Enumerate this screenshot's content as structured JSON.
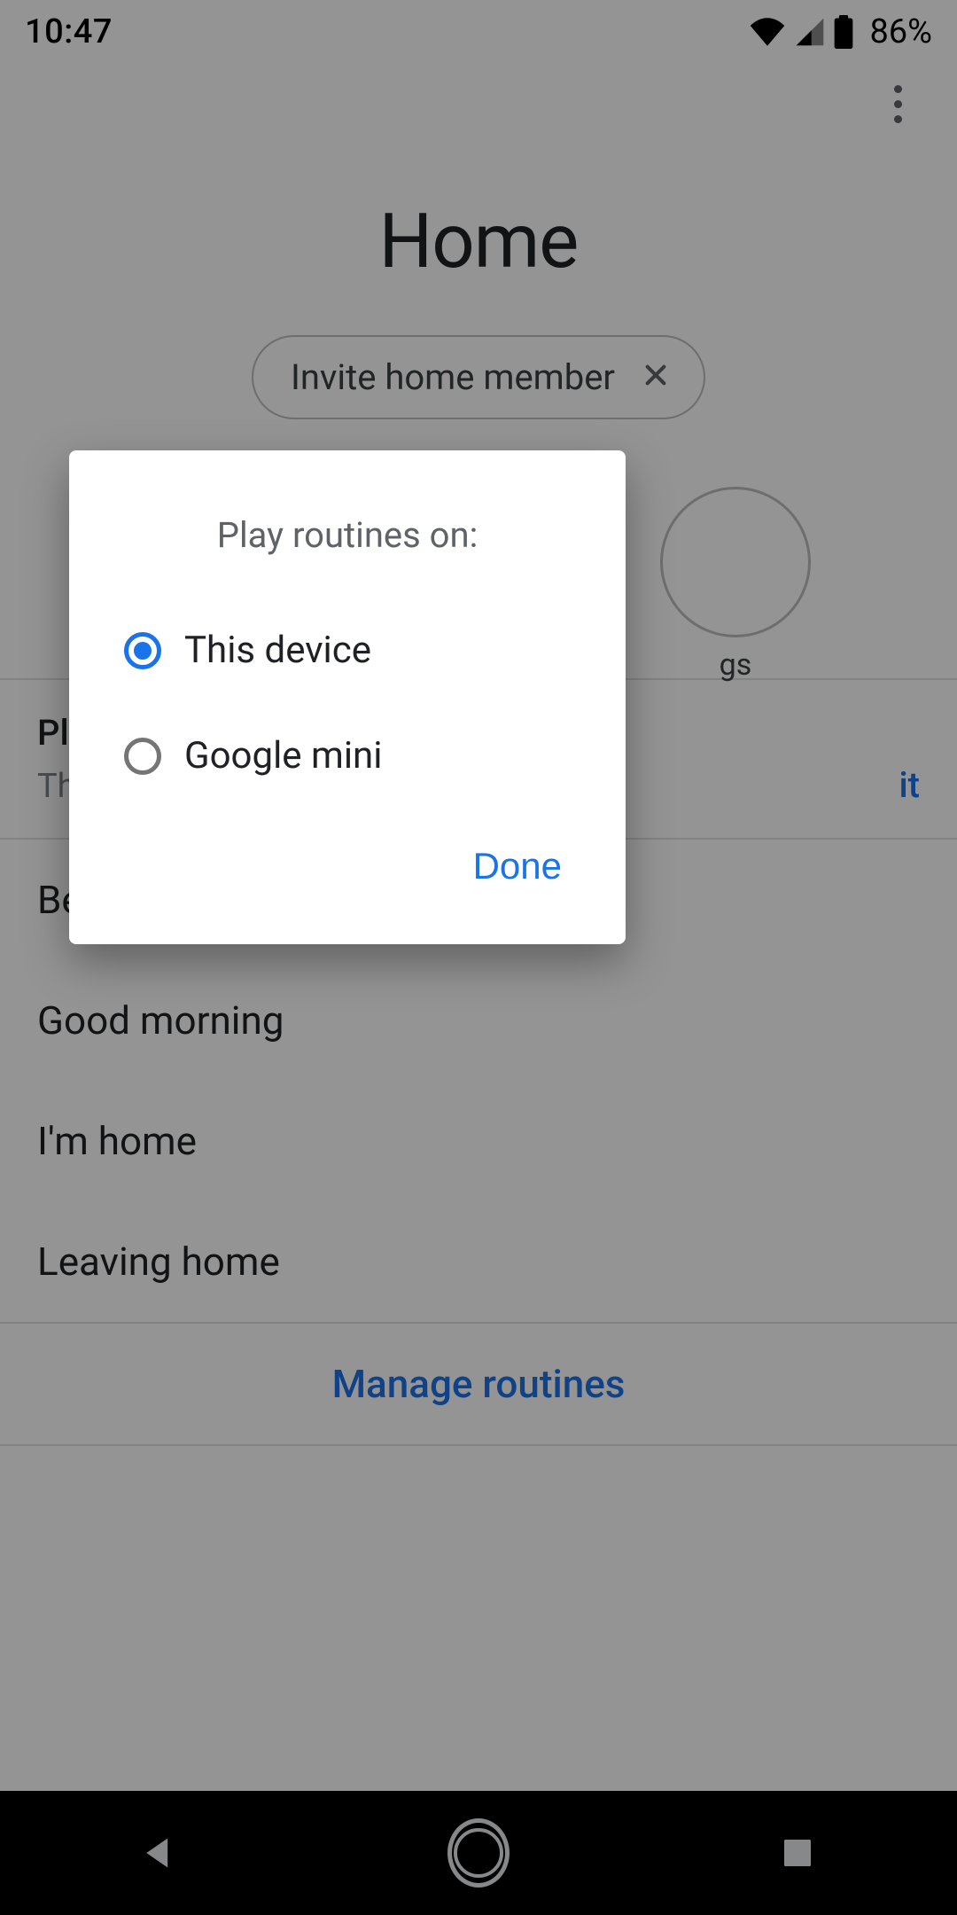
{
  "status": {
    "time": "10:47",
    "battery_pct": "86%"
  },
  "header": {
    "title": "Home"
  },
  "chip": {
    "label": "Invite home member"
  },
  "devices": {
    "last_caption_fragment": "gs"
  },
  "play_section": {
    "title_prefix": "Pla",
    "subtitle_prefix": "Thi",
    "edit_suffix": "it"
  },
  "routines": [
    {
      "label_prefix": "Be",
      "full_visible": "Be"
    },
    {
      "label": "Good morning"
    },
    {
      "label": "I'm home"
    },
    {
      "label": "Leaving home"
    }
  ],
  "manage": {
    "label": "Manage routines"
  },
  "dialog": {
    "title": "Play routines on:",
    "options": [
      {
        "label": "This device",
        "selected": true
      },
      {
        "label": "Google mini",
        "selected": false
      }
    ],
    "done": "Done"
  }
}
